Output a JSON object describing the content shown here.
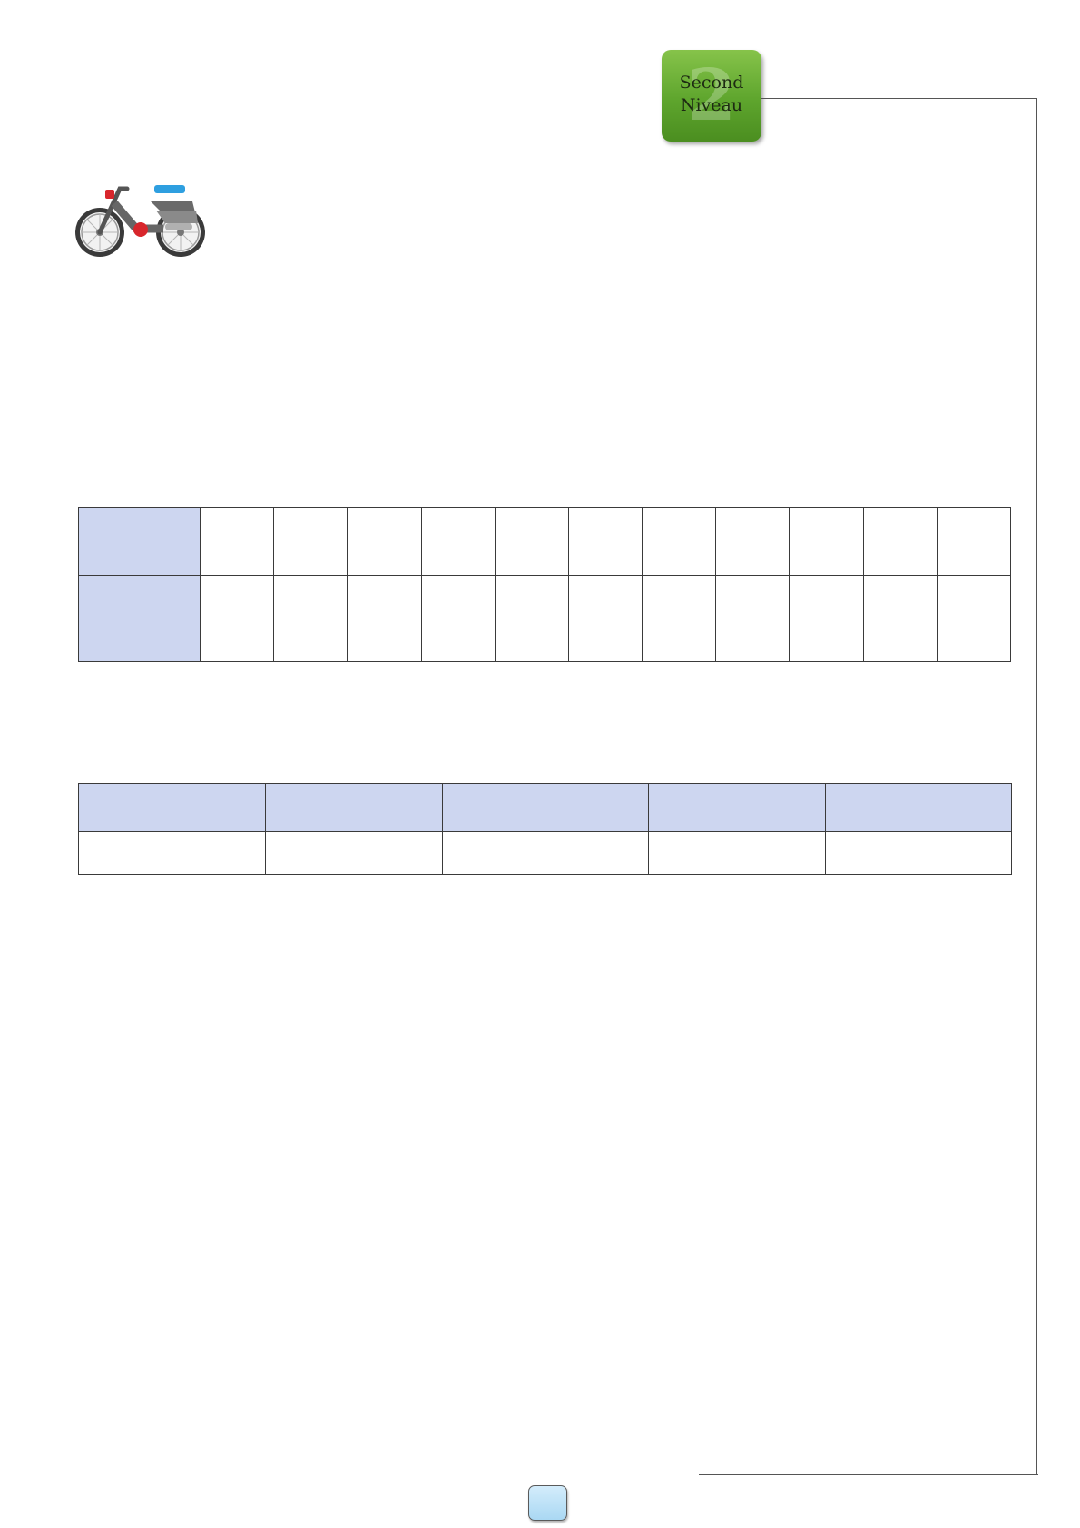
{
  "badge": {
    "number": "2",
    "line1": "Second",
    "line2": "Niveau",
    "color": "#5ea52d"
  },
  "icons": {
    "moped": "moped-icon"
  },
  "table_one": {
    "header_color": "#cdd6f0",
    "rows": [
      [
        "",
        "",
        "",
        "",
        "",
        "",
        "",
        "",
        "",
        "",
        "",
        ""
      ],
      [
        "",
        "",
        "",
        "",
        "",
        "",
        "",
        "",
        "",
        "",
        "",
        ""
      ]
    ]
  },
  "table_two": {
    "header_color": "#cdd6f0",
    "rows": [
      [
        "",
        "",
        "",
        "",
        ""
      ],
      [
        "",
        "",
        "",
        "",
        ""
      ]
    ]
  },
  "page_tab": {
    "label": "",
    "color": "#aad8f3"
  }
}
